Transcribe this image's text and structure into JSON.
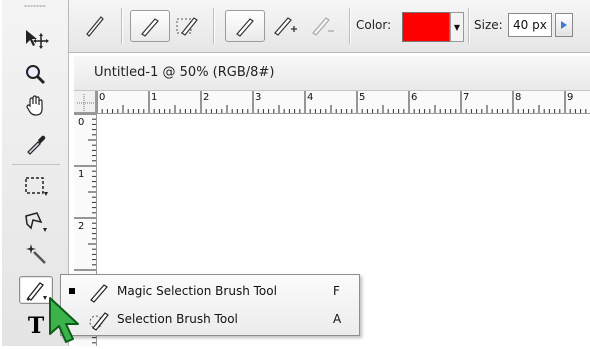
{
  "options_bar": {
    "color_label": "Color:",
    "color_value": "#ff0000",
    "size_label": "Size:",
    "size_value": "40 px"
  },
  "document": {
    "title": "Untitled-1 @ 50% (RGB/8#)",
    "ruler_h_labels": [
      "0",
      "1",
      "2",
      "3",
      "4",
      "5",
      "6",
      "7",
      "8",
      "9"
    ],
    "ruler_v_labels": [
      "0",
      "1",
      "2"
    ]
  },
  "tools": {
    "text_tool_glyph": "T"
  },
  "flyout": {
    "items": [
      {
        "label": "Magic Selection Brush Tool",
        "shortcut": "F",
        "selected": true
      },
      {
        "label": "Selection Brush Tool",
        "shortcut": "A",
        "selected": false
      }
    ]
  },
  "icons": [
    "move-tool-icon",
    "zoom-tool-icon",
    "hand-tool-icon",
    "eyedropper-tool-icon",
    "marquee-tool-icon",
    "lasso-tool-icon",
    "magic-wand-tool-icon",
    "magic-selection-brush-icon",
    "text-tool-icon"
  ]
}
